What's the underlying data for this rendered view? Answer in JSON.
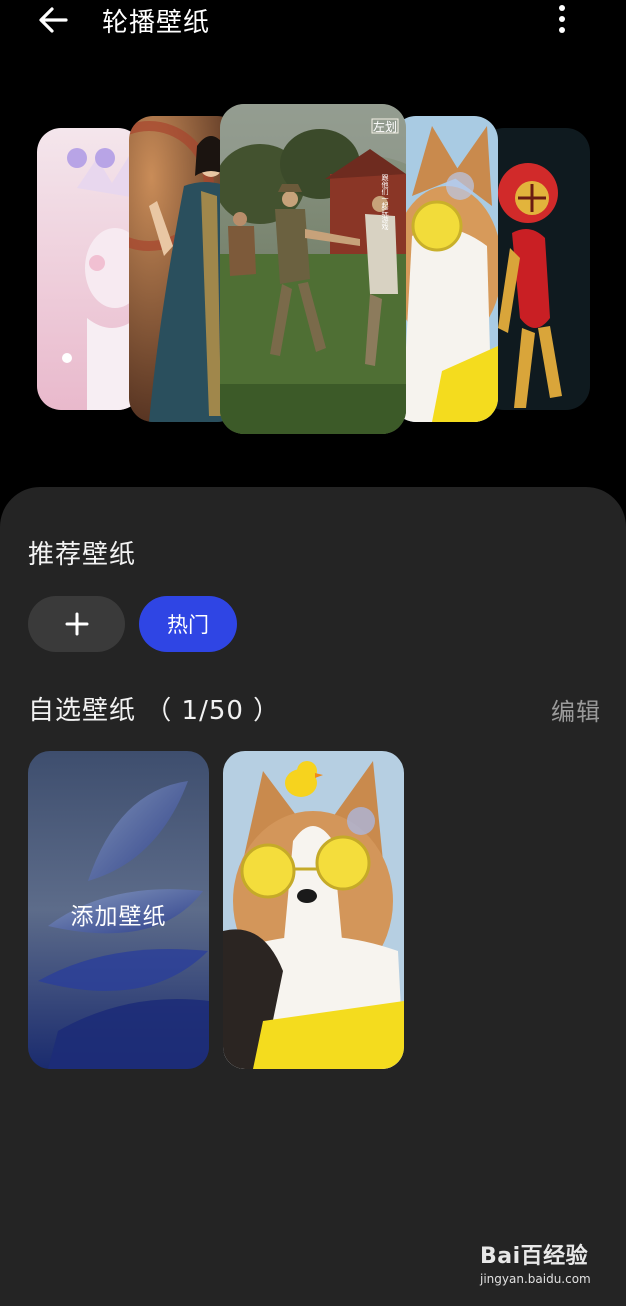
{
  "header": {
    "title": "轮播壁纸",
    "back_icon": "arrow-left-icon",
    "more_icon": "more-vertical-icon"
  },
  "carousel": {
    "cards": [
      {
        "name": "pink-toy-wallpaper"
      },
      {
        "name": "costume-portrait-wallpaper"
      },
      {
        "name": "painting-wallpaper",
        "overlay_title": "左划",
        "overlay_sub": "跟他们一起玩游戏"
      },
      {
        "name": "corgi-wallpaper"
      },
      {
        "name": "red-figure-wallpaper"
      }
    ]
  },
  "recommend": {
    "title": "推荐壁纸",
    "add_chip": "+",
    "hot_chip": "热门"
  },
  "custom": {
    "title": "自选壁纸 （ 1/50 ）",
    "edit_label": "编辑",
    "add_wallpaper_label": "添加壁纸"
  },
  "watermark": {
    "logo": "Bai百经验",
    "url": "jingyan.baidu.com"
  },
  "colors": {
    "accent": "#2f45e4",
    "sheet": "#242424",
    "background": "#000000"
  }
}
